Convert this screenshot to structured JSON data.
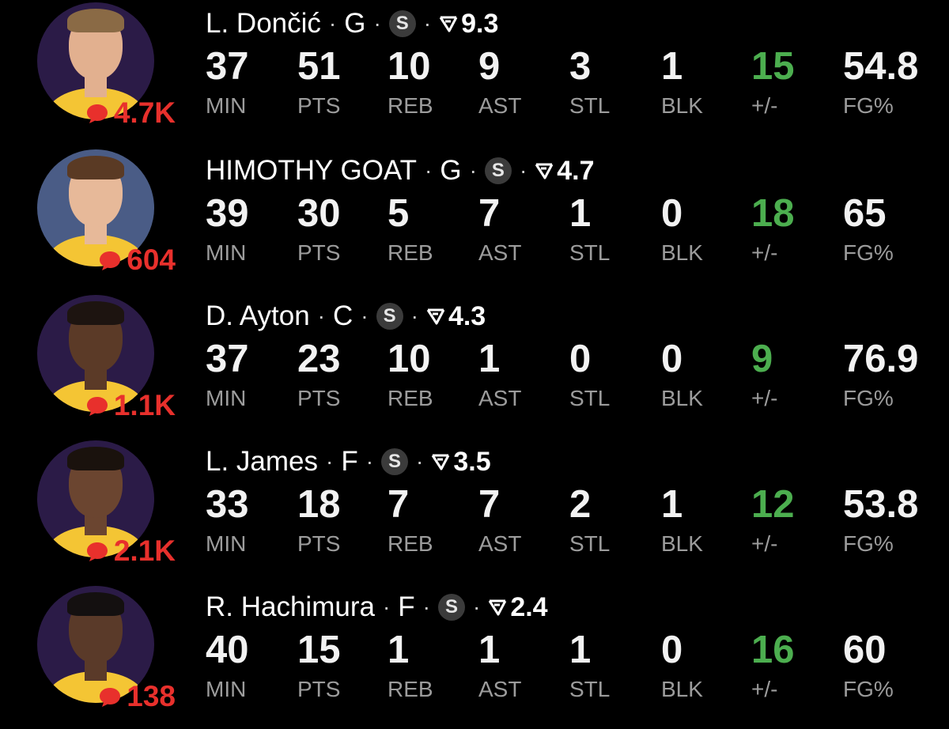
{
  "colors": {
    "background": "#000000",
    "comment_red": "#e8302c",
    "plus_minus_green": "#4cae4f",
    "label_gray": "#9c9c9c",
    "jersey_gold": "#f4c534",
    "avatar_purple": "#2b1b47"
  },
  "icons": {
    "comment": "comment-bubble-icon",
    "trend": "trend-arrow-icon",
    "starter": "starter-badge-icon"
  },
  "stat_labels": [
    "MIN",
    "PTS",
    "REB",
    "AST",
    "STL",
    "BLK",
    "+/-",
    "FG%"
  ],
  "players": [
    {
      "name": "L. Dončić",
      "position": "G",
      "badge": "S",
      "rating": "9.3",
      "comments": "4.7K",
      "stats": [
        "37",
        "51",
        "10",
        "9",
        "3",
        "1",
        "15",
        "54.8"
      ]
    },
    {
      "name": "HIMOTHY GOAT",
      "position": "G",
      "badge": "S",
      "rating": "4.7",
      "comments": "604",
      "stats": [
        "39",
        "30",
        "5",
        "7",
        "1",
        "0",
        "18",
        "65"
      ]
    },
    {
      "name": "D. Ayton",
      "position": "C",
      "badge": "S",
      "rating": "4.3",
      "comments": "1.1K",
      "stats": [
        "37",
        "23",
        "10",
        "1",
        "0",
        "0",
        "9",
        "76.9"
      ]
    },
    {
      "name": "L. James",
      "position": "F",
      "badge": "S",
      "rating": "3.5",
      "comments": "2.1K",
      "stats": [
        "33",
        "18",
        "7",
        "7",
        "2",
        "1",
        "12",
        "53.8"
      ]
    },
    {
      "name": "R. Hachimura",
      "position": "F",
      "badge": "S",
      "rating": "2.4",
      "comments": "138",
      "stats": [
        "40",
        "15",
        "1",
        "1",
        "1",
        "0",
        "16",
        "60"
      ]
    }
  ]
}
